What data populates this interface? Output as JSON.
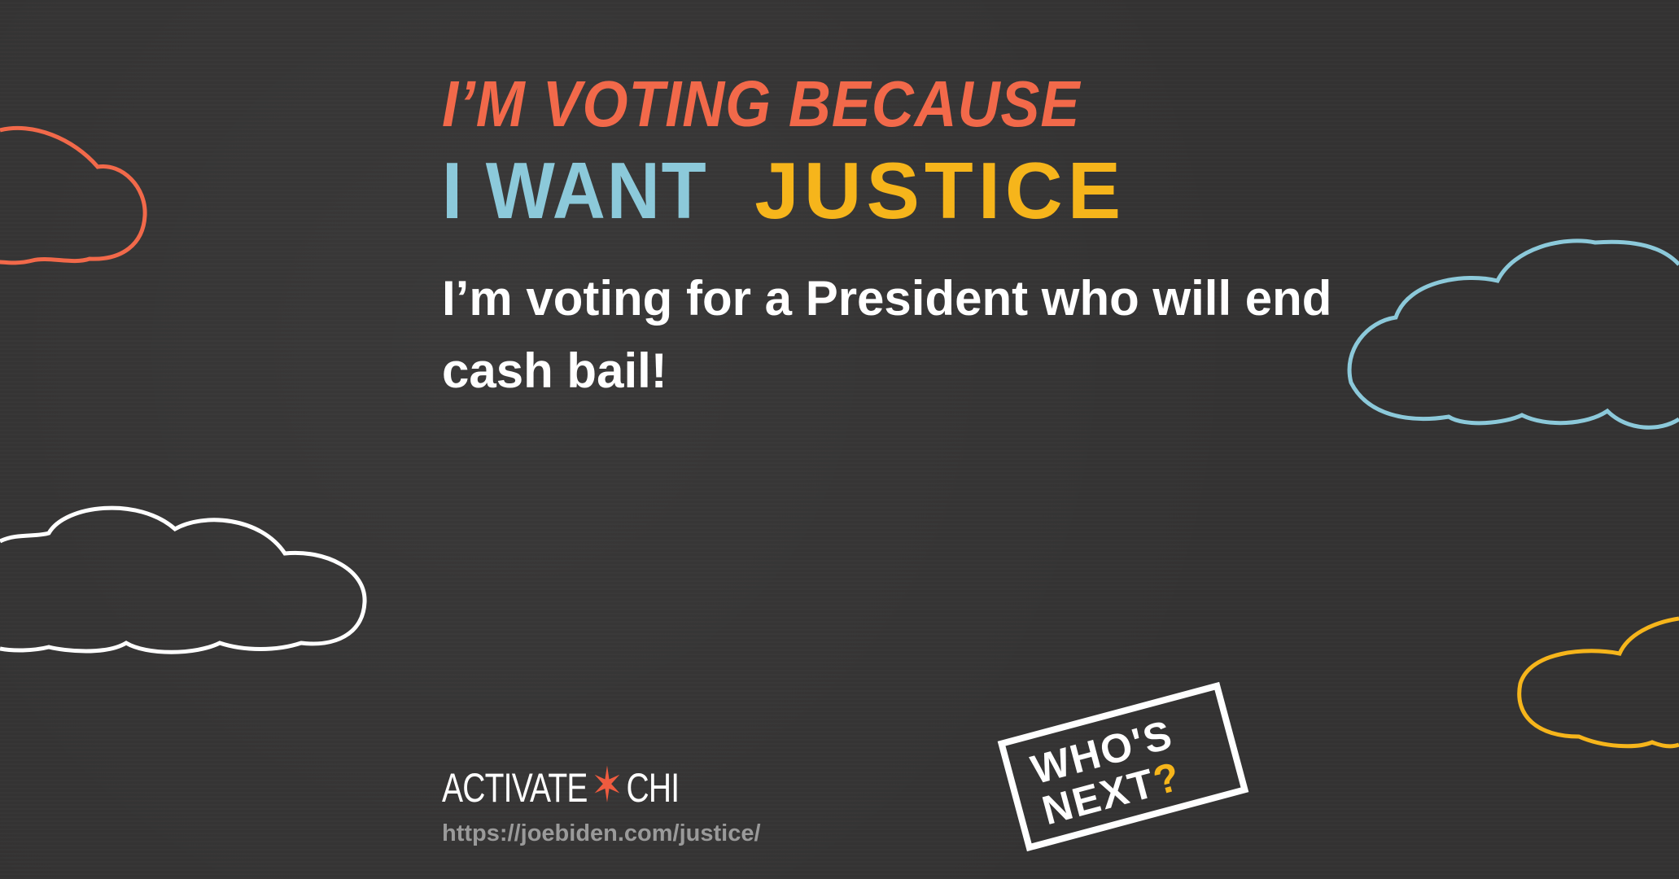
{
  "headline_top": "I’M VOTING BECAUSE",
  "headline_main": {
    "part1": "I WANT",
    "part2": "JUSTICE"
  },
  "body_text": "I’m voting for a President who will end cash bail!",
  "logo": {
    "left": "ACTIVATE",
    "star": "✶",
    "right": "CHI"
  },
  "url": "https://joebiden.com/justice/",
  "sign": {
    "line1": "WHO'S",
    "line2": "NEXT",
    "mark": "?"
  },
  "colors": {
    "background": "#333232",
    "orange": "#f2694a",
    "blue": "#8cc9da",
    "yellow": "#f6b51b",
    "white": "#ffffff"
  }
}
